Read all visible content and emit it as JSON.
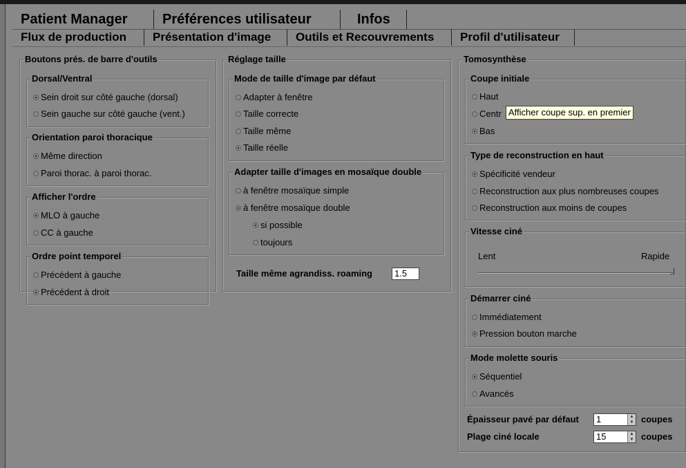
{
  "tabs_top": [
    "Patient Manager",
    "Préférences utilisateur",
    "Infos"
  ],
  "tabs_second": [
    "Flux de production",
    "Présentation d'image",
    "Outils et Recouvrements",
    "Profil d'utilisateur"
  ],
  "left": {
    "title": "Boutons prés. de barre d'outils",
    "dorsal": {
      "title": "Dorsal/Ventral",
      "options": [
        "Sein droit sur côté gauche (dorsal)",
        "Sein gauche sur côté gauche (vent.)"
      ],
      "selected": 0
    },
    "orientation": {
      "title": "Orientation paroi thoracique",
      "options": [
        "Même direction",
        "Paroi thorac. à paroi thorac."
      ],
      "selected": 0
    },
    "ordre": {
      "title": "Afficher l'ordre",
      "options": [
        "MLO à gauche",
        "CC à gauche"
      ],
      "selected": 0
    },
    "temporel": {
      "title": "Ordre point temporel",
      "options": [
        "Précédent à gauche",
        "Précédent à droit"
      ],
      "selected": 1
    }
  },
  "middle": {
    "title": "Réglage taille",
    "mode": {
      "title": "Mode de taille d'image par défaut",
      "options": [
        "Adapter à fenêtre",
        "Taille correcte",
        "Taille même",
        "Taille réelle"
      ],
      "selected": 3
    },
    "mosaic": {
      "title": "Adapter taille d'images en mosaïque double",
      "options": [
        "à fenêtre mosaïque simple",
        "à fenêtre mosaïque double"
      ],
      "selected": 1,
      "sub_options": [
        "si possible",
        "toujours"
      ],
      "sub_selected": 0
    },
    "roaming_label": "Taille même agrandiss. roaming",
    "roaming_value": "1.5"
  },
  "right": {
    "title": "Tomosynthèse",
    "coupe": {
      "title": "Coupe initiale",
      "options": [
        "Haut",
        "Centre",
        "Bas"
      ],
      "visible_text": "Centr",
      "selected": 2
    },
    "tooltip": "Afficher coupe sup. en premier",
    "reconstruction": {
      "title": "Type de reconstruction en haut",
      "options": [
        "Spécificité vendeur",
        "Reconstruction aux plus nombreuses coupes",
        "Reconstruction aux moins de coupes"
      ],
      "selected": 0
    },
    "vitesse": {
      "title": "Vitesse ciné",
      "min_label": "Lent",
      "max_label": "Rapide",
      "value_fraction": 1.0
    },
    "demarrer": {
      "title": "Démarrer ciné",
      "options": [
        "Immédiatement",
        "Pression bouton marche"
      ],
      "selected": 1
    },
    "molette": {
      "title": "Mode molette souris",
      "options": [
        "Séquentiel",
        "Avancés"
      ],
      "selected": 0
    },
    "epaisseur": {
      "label": "Épaisseur pavé par défaut",
      "value": "1",
      "unit": "coupes"
    },
    "plage": {
      "label": "Plage ciné locale",
      "value": "15",
      "unit": "coupes"
    }
  }
}
